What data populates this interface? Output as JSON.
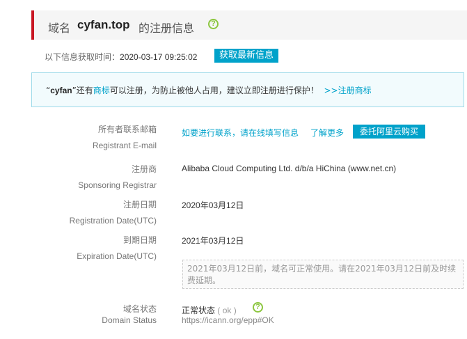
{
  "header": {
    "prefix": "域名",
    "domain": "cyfan.top",
    "suffix": "的注册信息",
    "help_icon": "question-circle-icon"
  },
  "fetch": {
    "label": "以下信息获取时间：",
    "time": "2020-03-17 09:25:02",
    "button": "获取最新信息"
  },
  "notice": {
    "open_quote": "“",
    "name": "cyfan",
    "mid1": "”还有",
    "trademark_link": "商标",
    "mid2": "可以注册，为防止被他人占用，建议立即注册进行保护！",
    "register_link": ">>注册商标"
  },
  "fields": {
    "email": {
      "label_cn": "所有者联系邮箱",
      "label_en": "Registrant E-mail",
      "contact_link": "如要进行联系，请在线填写信息",
      "more_link": "了解更多",
      "buy_button": "委托阿里云购买"
    },
    "registrar": {
      "label_cn": "注册商",
      "label_en": "Sponsoring Registrar",
      "value": "Alibaba Cloud Computing Ltd. d/b/a HiChina (www.net.cn)"
    },
    "reg_date": {
      "label_cn": "注册日期",
      "label_en": "Registration Date(UTC)",
      "value": "2020年03月12日"
    },
    "exp_date": {
      "label_cn": "到期日期",
      "label_en": "Expiration Date(UTC)",
      "value": "2021年03月12日",
      "hint": "2021年03月12日前，域名可正常使用。请在2021年03月12日前及时续费延期。"
    },
    "status": {
      "label_cn": "域名状态",
      "label_en": "Domain Status",
      "value": "正常状态",
      "code": "( ok )",
      "url": "https://icann.org/epp#OK"
    }
  },
  "colors": {
    "accent": "#00a2ca",
    "header_bar": "#c81623",
    "help_icon": "#8cc63f"
  }
}
